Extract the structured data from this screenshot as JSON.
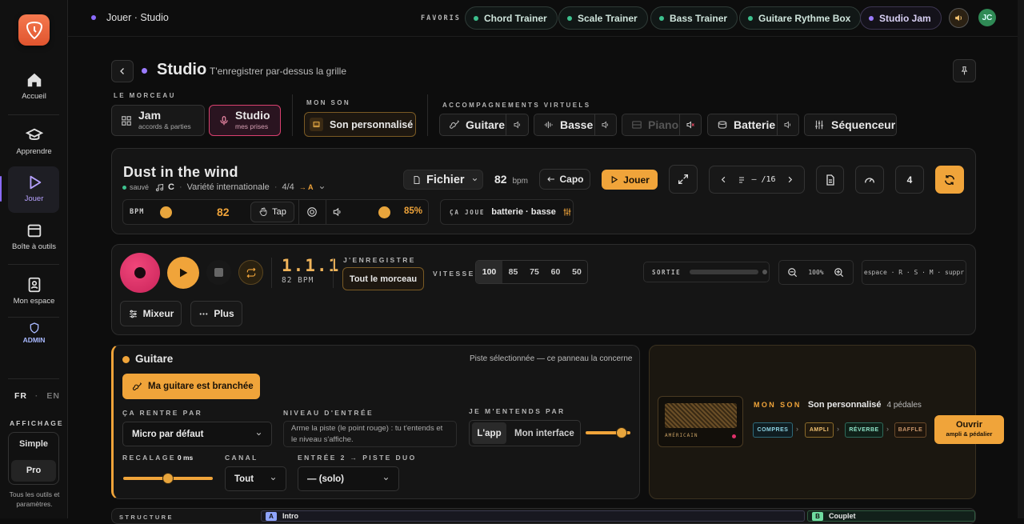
{
  "app": {
    "breadcrumb": "Jouer · Studio",
    "avatar_initials": "JC"
  },
  "favorites": {
    "label": "FAVORIS",
    "items": [
      "Chord Trainer",
      "Scale Trainer",
      "Bass Trainer",
      "Guitare Rythme Box",
      "Studio Jam"
    ]
  },
  "sidebar": {
    "items": [
      {
        "label": "Accueil",
        "icon": "home-icon"
      },
      {
        "label": "Apprendre",
        "icon": "graduation-cap-icon"
      },
      {
        "label": "Jouer",
        "icon": "play-icon"
      },
      {
        "label": "Boîte à outils",
        "icon": "toolbox-icon"
      },
      {
        "label": "Mon espace",
        "icon": "user-card-icon"
      },
      {
        "label": "ADMIN",
        "icon": "shield-icon"
      }
    ],
    "lang": {
      "fr": "FR",
      "sep": "·",
      "en": "EN"
    },
    "affichage_label": "AFFICHAGE",
    "mode_simple": "Simple",
    "mode_pro": "Pro",
    "note": "Tous les outils et paramètres."
  },
  "header": {
    "title": "Studio",
    "subtitle": "T'enregistrer par-dessus la grille"
  },
  "morceau": {
    "label": "LE MORCEAU",
    "jam_title": "Jam",
    "jam_sub": "accords & parties",
    "studio_title": "Studio",
    "studio_sub": "mes prises"
  },
  "mon_son": {
    "label": "MON SON",
    "button": "Son personnalisé"
  },
  "accomp": {
    "label": "ACCOMPAGNEMENTS VIRTUELS",
    "guitare": "Guitare",
    "basse": "Basse",
    "piano": "Piano",
    "batterie": "Batterie",
    "sequenceur": "Séquenceur"
  },
  "song": {
    "title": "Dust in the wind",
    "saved": "sauvé",
    "key": "C",
    "genre": "Variété internationale",
    "meter": "4/4",
    "section": "→ A",
    "fichier": "Fichier",
    "bpm_value": "82",
    "bpm_unit": "bpm",
    "capo": "Capo",
    "jouer": "Jouer",
    "bar_position": "– /16",
    "count": "4",
    "bpm_label": "BPM",
    "bpm_slider_value": "82",
    "tap": "Tap",
    "volume_pct": "85%",
    "ca_joue_label": "ÇA JOUE",
    "ca_joue_value": "batterie · basse"
  },
  "transport": {
    "position": "1.1.1",
    "bpm_caption": "82 BPM",
    "record_label": "J'ENREGISTRE",
    "record_option": "Tout le morceau",
    "vitesse_label": "VITESSE",
    "speeds": [
      "100",
      "85",
      "75",
      "60",
      "50"
    ],
    "sortie_label": "SORTIE",
    "sortie_level": 0.0,
    "zoom": "100%",
    "shortcuts": "espace · R · S · M · suppr",
    "mixeur": "Mixeur",
    "plus": "Plus"
  },
  "guitar": {
    "title": "Guitare",
    "selected_note": "Piste sélectionnée — ce panneau la concerne",
    "plugged_button": "Ma guitare est branchée",
    "input_label": "ÇA RENTRE PAR",
    "input_value": "Micro par défaut",
    "level_label": "NIVEAU D'ENTRÉE",
    "level_hint": "Arme la piste (le point rouge) : tu t'entends et le niveau s'affiche.",
    "monitor_label": "JE M'ENTENDS PAR",
    "monitor_app": "L'app",
    "monitor_iface": "Mon interface",
    "monitor_volume": 0.8,
    "recalage_label": "RECALAGE",
    "recalage_value": "0 ms",
    "recalage_pos": 0.5,
    "canal_label": "CANAL",
    "canal_value": "Tout",
    "duo_label": "ENTRÉE 2 → PISTE DUO",
    "duo_value": "— (solo)"
  },
  "amp": {
    "label": "MON SON",
    "name": "Son personnalisé",
    "pedals": "4 pédales",
    "brand": "AMÉRICAIN",
    "chain": [
      "COMPRES",
      "AMPLI",
      "RÉVERBE",
      "BAFFLE"
    ],
    "open_title": "Ouvrir",
    "open_sub": "ampli & pédalier"
  },
  "structure": {
    "label": "STRUCTURE",
    "sections": [
      {
        "letter": "A",
        "name": "Intro"
      },
      {
        "letter": "B",
        "name": "Couplet"
      }
    ]
  },
  "colors": {
    "accent": "#f0a43a",
    "record": "#e0306a",
    "active": "#8b6bff",
    "fav_dot": "#3dc18e"
  }
}
